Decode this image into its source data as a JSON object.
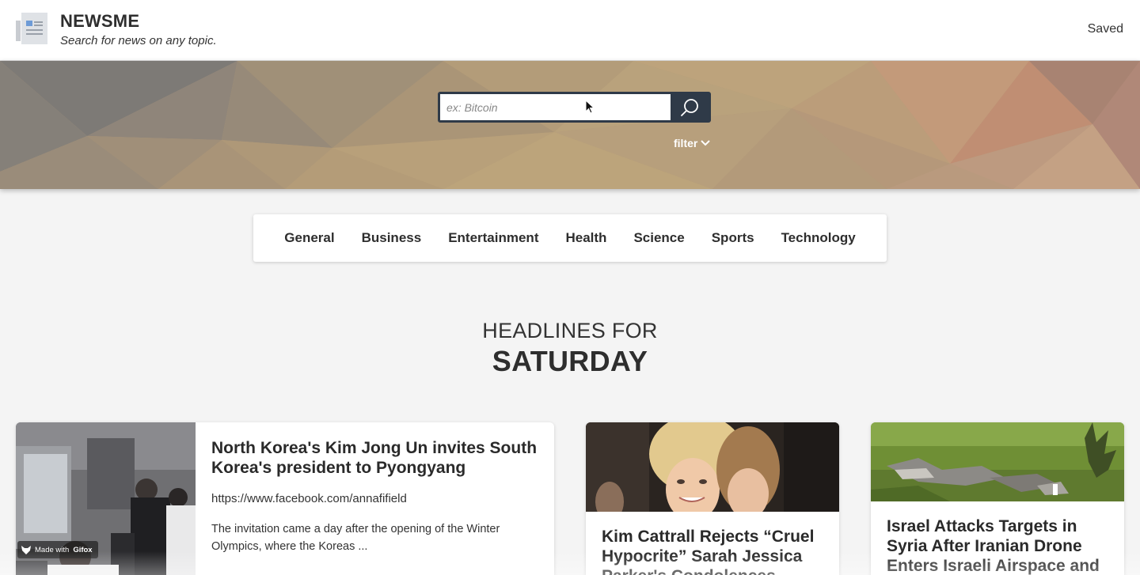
{
  "header": {
    "brand_title": "NEWSME",
    "tagline": "Search for news on any topic.",
    "saved_label": "Saved",
    "logo_icon": "newspaper-icon"
  },
  "search": {
    "placeholder": "ex: Bitcoin",
    "value": "",
    "button_icon": "search-icon",
    "filter_label": "filter",
    "filter_icon": "chevron-down-icon"
  },
  "categories": [
    "General",
    "Business",
    "Entertainment",
    "Health",
    "Science",
    "Sports",
    "Technology"
  ],
  "headline": {
    "prefix": "HEADLINES FOR",
    "day": "SATURDAY"
  },
  "articles": [
    {
      "title": "North Korea's Kim Jong Un invites South Korea's president to Pyongyang",
      "source": "https://www.facebook.com/annafifield",
      "description": "The invitation came a day after the opening of the Winter Olympics, where the Koreas ..."
    },
    {
      "title": "Kim Cattrall Rejects “Cruel Hypocrite” Sarah Jessica Parker's Condolences"
    },
    {
      "title": "Israel Attacks Targets in Syria After Iranian Drone Enters Israeli Airspace and"
    }
  ],
  "overlay": {
    "badge_prefix": "Made with",
    "badge_brand": "Gifox"
  },
  "colors": {
    "search_border": "#2f3a48",
    "hero_warm": "#b99a72",
    "hero_grey": "#7d7770"
  }
}
